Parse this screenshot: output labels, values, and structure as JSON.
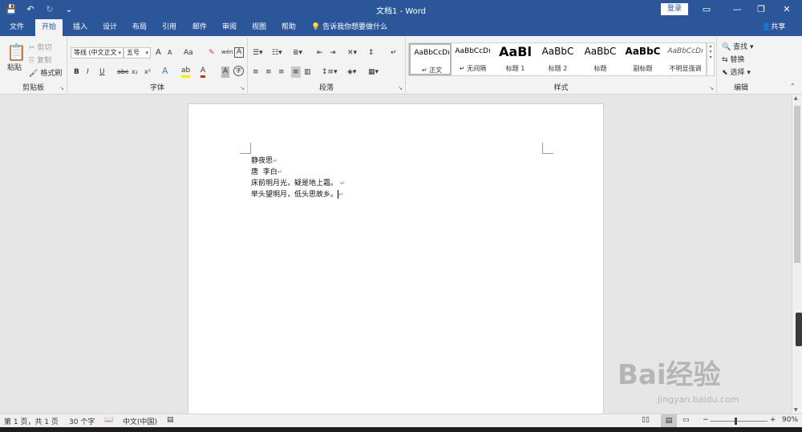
{
  "titlebar": {
    "title": "文档1 - Word",
    "login": "登录",
    "qat": {
      "save_icon": "💾",
      "undo_icon": "↶",
      "redo_icon": "↻",
      "customize_icon": "⌄"
    },
    "controls": {
      "ribbon_display_icon": "▭",
      "minimize_icon": "—",
      "restore_icon": "❐",
      "close_icon": "✕"
    }
  },
  "tabs": [
    {
      "label": "文件"
    },
    {
      "label": "开始"
    },
    {
      "label": "插入"
    },
    {
      "label": "设计"
    },
    {
      "label": "布局"
    },
    {
      "label": "引用"
    },
    {
      "label": "邮件"
    },
    {
      "label": "审阅"
    },
    {
      "label": "视图"
    },
    {
      "label": "帮助"
    }
  ],
  "tell_me": "告诉我你想要做什么",
  "share": "共享",
  "clipboard": {
    "label": "剪贴板",
    "paste": "粘贴",
    "cut": "剪切",
    "copy": "复制",
    "format_painter": "格式刷"
  },
  "font": {
    "label": "字体",
    "font_name": "等线 (中文正文",
    "font_size": "五号",
    "bold": "B",
    "italic": "I",
    "underline": "U",
    "strike": "abc",
    "sub": "x₂",
    "sup": "x²",
    "grow": "A",
    "shrink": "A",
    "case": "Aa",
    "clear": "A",
    "phonetic": "wén",
    "border_char": "A",
    "effects": "A",
    "highlight": "ab",
    "color": "A",
    "shading": "A",
    "enclose": "字"
  },
  "paragraph": {
    "label": "段落"
  },
  "styles": {
    "label": "样式",
    "items": [
      {
        "sample": "AaBbCcDı",
        "name": "↵ 正文"
      },
      {
        "sample": "AaBbCcDı",
        "name": "↵ 无间隔"
      },
      {
        "sample": "AaBl",
        "name": "标题 1"
      },
      {
        "sample": "AaBbC",
        "name": "标题 2"
      },
      {
        "sample": "AaBbC",
        "name": "标题"
      },
      {
        "sample": "AaBbC",
        "name": "副标题"
      },
      {
        "sample": "AaBbCcDı",
        "name": "不明显强调"
      }
    ]
  },
  "editing": {
    "label": "编辑",
    "find": "查找",
    "replace": "替换",
    "select": "选择"
  },
  "document": {
    "lines": [
      {
        "text": "静夜思",
        "mark": "↵"
      },
      {
        "text": "唐  李白",
        "mark": "↵"
      },
      {
        "text": "床前明月光，疑是地上霜。",
        "mark": "↵"
      },
      {
        "text": "举头望明月，低头思故乡。",
        "mark": "↵"
      }
    ]
  },
  "status": {
    "page": "第 1 页，共 1 页",
    "words": "30 个字",
    "language": "中文(中国)",
    "zoom": "90%",
    "zoom_fraction": 0.45
  },
  "watermark": {
    "big": "Bai经验",
    "small": "jingyan.baidu.com"
  }
}
